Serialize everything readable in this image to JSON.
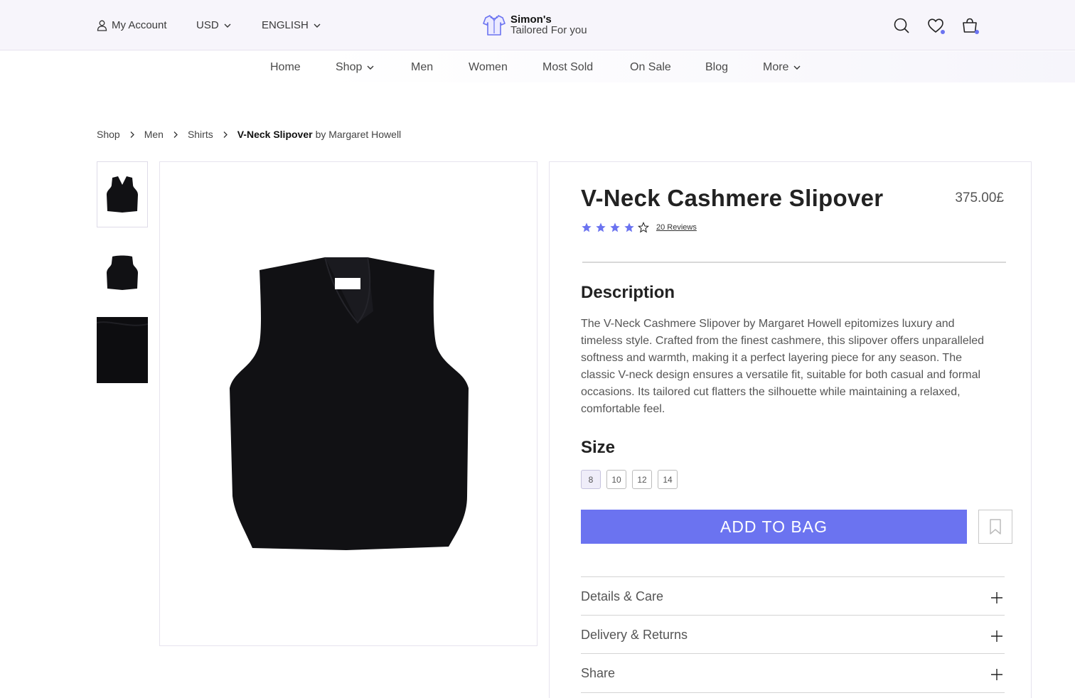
{
  "topbar": {
    "account": "My Account",
    "currency": "USD",
    "language": "ENGLISH",
    "logo_name": "Simon's",
    "logo_tagline": "Tailored For you"
  },
  "nav": [
    "Home",
    "Shop",
    "Men",
    "Women",
    "Most Sold",
    "On Sale",
    "Blog",
    "More"
  ],
  "breadcrumb": {
    "items": [
      "Shop",
      "Men",
      "Shirts"
    ],
    "current": "V-Neck Slipover",
    "brand": "by Margaret Howell"
  },
  "product": {
    "title": "V-Neck Cashmere Slipover",
    "price": "375.00£",
    "rating": 4,
    "rating_max": 5,
    "reviews": "20 Reviews",
    "description_heading": "Description",
    "description": "The V-Neck Cashmere Slipover by Margaret Howell epitomizes luxury and timeless style. Crafted from the finest cashmere, this slipover offers unparalleled softness and warmth, making it a perfect layering piece for any season. The classic V-neck design ensures a versatile fit, suitable for both casual and formal occasions. Its tailored cut flatters the silhouette while maintaining a relaxed, comfortable feel.",
    "size_heading": "Size",
    "sizes": [
      "8",
      "10",
      "12",
      "14"
    ],
    "selected_size": "8",
    "add_to_bag": "ADD TO BAG"
  },
  "accordion": [
    "Details & Care",
    "Delivery & Returns",
    "Share"
  ],
  "colors": {
    "accent": "#6b73f0",
    "topbar_bg": "#f7f5fb",
    "product": "#111114"
  }
}
